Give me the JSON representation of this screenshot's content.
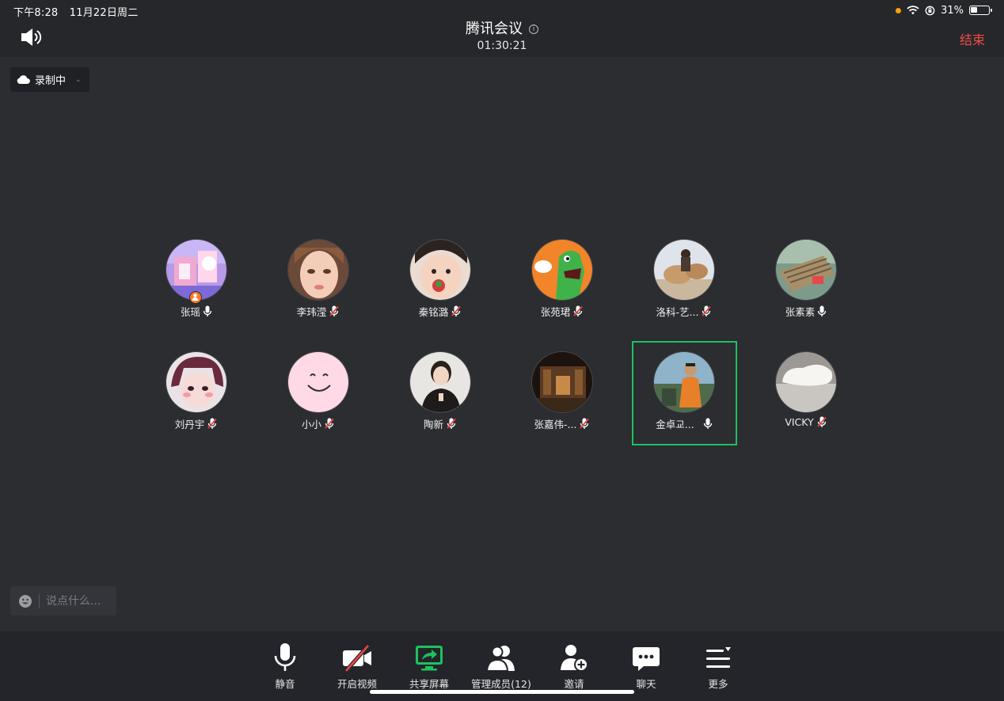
{
  "status_bar": {
    "time": "下午8:28",
    "date": "11月22日周二",
    "battery": "31%"
  },
  "header": {
    "title": "腾讯会议",
    "timer": "01:30:21",
    "end_label": "结束",
    "end_color": "#f04b45"
  },
  "recording": {
    "label": "录制中"
  },
  "participants": [
    {
      "name": "张瑶",
      "mic": "on",
      "host": true
    },
    {
      "name": "李玮滢",
      "mic": "muted"
    },
    {
      "name": "秦铭潞",
      "mic": "muted"
    },
    {
      "name": "张苑珺",
      "mic": "muted"
    },
    {
      "name": "洛科-艺...",
      "mic": "muted"
    },
    {
      "name": "张素素",
      "mic": "on"
    },
    {
      "name": "刘丹宇",
      "mic": "muted"
    },
    {
      "name": "小小",
      "mic": "muted"
    },
    {
      "name": "陶新",
      "mic": "muted"
    },
    {
      "name": "张嘉伟-...",
      "mic": "muted"
    },
    {
      "name": "金卓교...",
      "mic": "on",
      "active_speaker": true
    },
    {
      "name": "VICKY",
      "mic": "muted"
    }
  ],
  "chat": {
    "placeholder": "说点什么..."
  },
  "toolbar": {
    "mute": "静音",
    "video": "开启视频",
    "share": "共享屏幕",
    "members": "管理成员(12)",
    "invite": "邀请",
    "chat": "聊天",
    "more": "更多"
  },
  "colors": {
    "accent_green": "#1ec15f",
    "muted_red": "#e8463f",
    "background": "#2b2d31"
  }
}
